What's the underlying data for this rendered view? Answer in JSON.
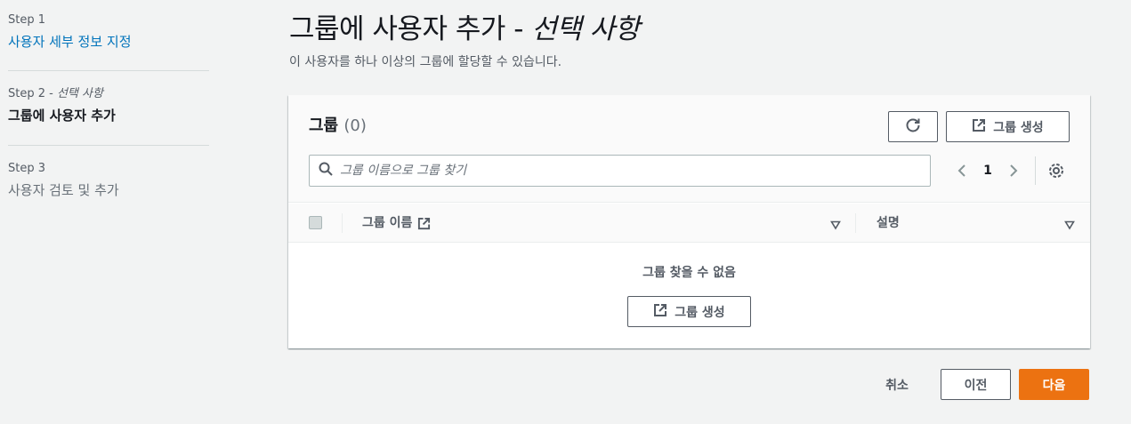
{
  "wizard": {
    "steps": [
      {
        "label": "Step 1",
        "title": "사용자 세부 정보 지정"
      },
      {
        "label": "Step 2 - ",
        "optional": "선택 사항",
        "title": "그룹에 사용자 추가"
      },
      {
        "label": "Step 3",
        "title": "사용자 검토 및 추가"
      }
    ]
  },
  "header": {
    "title": "그룹에 사용자 추가 - ",
    "title_optional": "선택 사항",
    "description": "이 사용자를 하나 이상의 그룹에 할당할 수 있습니다."
  },
  "groups": {
    "title": "그룹",
    "count": "(0)",
    "create_button": "그룹 생성",
    "search_placeholder": "그룹 이름으로 그룹 찾기",
    "page": "1",
    "columns": {
      "name": "그룹 이름",
      "description": "설명"
    },
    "empty_text": "그룹 찾을 수 없음",
    "empty_create_button": "그룹 생성"
  },
  "footer": {
    "cancel": "취소",
    "previous": "이전",
    "next": "다음"
  },
  "colors": {
    "link": "#0073bb",
    "primary": "#ec7211",
    "background": "#f2f3f3"
  }
}
